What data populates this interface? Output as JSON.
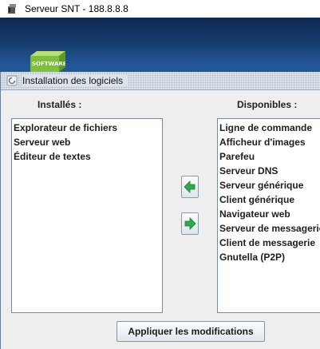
{
  "window": {
    "title": "Serveur SNT - 188.8.8.8",
    "app_icon": "application-icon"
  },
  "desktop": {
    "shortcut_label": "SOFTWARE",
    "shortcut_icon": "software-icon"
  },
  "dialog": {
    "title": "Installation des logiciels",
    "icon": "frame-icon",
    "installed_label": "Installés :",
    "available_label": "Disponibles :",
    "installed": [
      "Explorateur de fichiers",
      "Serveur web",
      "Éditeur de textes"
    ],
    "available": [
      "Ligne de commande",
      "Afficheur d'images",
      "Parefeu",
      "Serveur DNS",
      "Serveur générique",
      "Client générique",
      "Navigateur web",
      "Serveur de messagerie",
      "Client de messagerie",
      "Gnutella (P2P)"
    ],
    "add_arrow_icon": "arrow-left-icon",
    "remove_arrow_icon": "arrow-right-icon",
    "apply_label": "Appliquer les modifications"
  },
  "colors": {
    "arrow_green": "#2fa84f",
    "desktop_blue": "#1d4a84",
    "frame_bg": "#eeeeee"
  }
}
